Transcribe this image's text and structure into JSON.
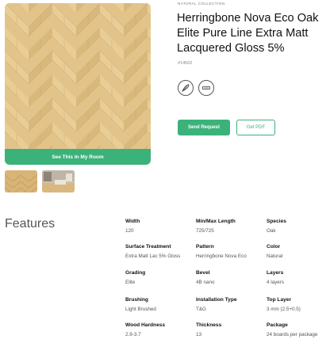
{
  "gallery": {
    "room_button_label": "See This In My Room"
  },
  "product": {
    "collection": "NATURAL COLLECTION",
    "title": "Herringbone Nova Eco Oak Elite Pure Line Extra Matt Lacquered Gloss 5%",
    "sku": "#14502",
    "icons": [
      "wood-species-icon",
      "plank-profile-icon"
    ]
  },
  "actions": {
    "send_request_label": "Send Request",
    "get_pdf_label": "Get PDF"
  },
  "features": {
    "heading": "Features",
    "items": [
      {
        "label": "Width",
        "value": "120"
      },
      {
        "label": "Min/Max Length",
        "value": "725/725"
      },
      {
        "label": "Species",
        "value": "Oak"
      },
      {
        "label": "Surface Treatment",
        "value": "Extra Matt Lac 5% Gloss"
      },
      {
        "label": "Pattern",
        "value": "Herringbone Nova Eco"
      },
      {
        "label": "Color",
        "value": "Natural"
      },
      {
        "label": "Grading",
        "value": "Elite"
      },
      {
        "label": "Bevel",
        "value": "4B nano"
      },
      {
        "label": "Layers",
        "value": "4 layers"
      },
      {
        "label": "Brushing",
        "value": "Light Brushed"
      },
      {
        "label": "Installation Type",
        "value": "T&G"
      },
      {
        "label": "Top Layer",
        "value": "3 mm (2.5+0.5)"
      },
      {
        "label": "Wood Hardness",
        "value": "2.9-3.7"
      },
      {
        "label": "Thickness",
        "value": "13"
      },
      {
        "label": "Package",
        "value": "24 boards per package"
      }
    ]
  },
  "colors": {
    "accent": "#3cb27b",
    "wood_light": "#e6c98f",
    "wood_mid": "#d6b477"
  }
}
